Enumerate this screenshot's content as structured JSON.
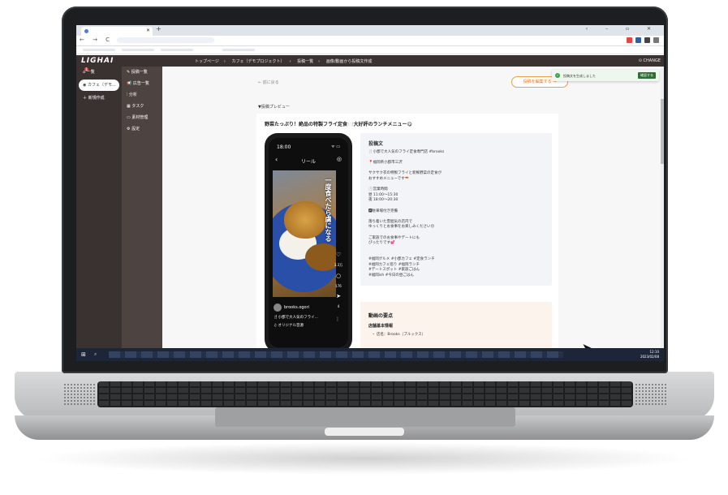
{
  "browser": {
    "tab_title": "",
    "new_tab": "+",
    "window_controls": "‹ – ▫ ✕",
    "nav": "← → C ⌂",
    "url": ""
  },
  "header": {
    "logo": "LIGHAI",
    "breadcrumbs": [
      "トップページ",
      "カフェ（デモプロジェクト）",
      "投稿一覧",
      "画像/動画から投稿文作成"
    ],
    "change": "CHANGE"
  },
  "side1": {
    "items": [
      {
        "label": "一覧",
        "badge": "1"
      },
      {
        "label": "カフェ（デモ..."
      },
      {
        "label": "＋ 新規作成"
      }
    ]
  },
  "side2": {
    "items": [
      "投稿一覧",
      "広告一覧",
      "分析",
      "タスク",
      "素材管理",
      "設定"
    ]
  },
  "main": {
    "back": "← 前に戻る",
    "edit_button": "投稿を編集する →",
    "toast_message": "投稿文を生成しました",
    "toast_button": "確認する",
    "preview_label": "▼投稿プレビュー",
    "post_title": "野菜たっぷり！絶品の特製フライ定食🍽️大好評のランチメニュー😋"
  },
  "phone": {
    "time": "18:00",
    "status": "ᯤ ▭",
    "reel": "リール",
    "overlay": "一度食べたら虜になる",
    "likes": "3.3万",
    "comments": "176",
    "shares": "4",
    "account": "brooks.ogori",
    "caption": "🍴小郡で大人気のフライ...",
    "audio": "♫ オリジナル音源"
  },
  "post_text": {
    "heading": "投稿文",
    "lines": [
      "🍴小郡で大人気のフライ定食専門店 #brooks",
      "",
      "📍福岡県小郡市三沢",
      "",
      "サクサク衣の特製フライと新鮮野菜の定食が",
      "おすすめメニューです🥗",
      "",
      "🕒営業時間",
      "昼 11:00〜15:30",
      "夜 18:00〜20:30",
      "",
      "🅿駐車場付き完備",
      "",
      "落ち着いた雰囲気の店内で",
      "ゆっくりとお食事をお楽しみください😊",
      "",
      "ご家族でのお食事やデートにも",
      "ぴったりです💕",
      "",
      "",
      "#福岡グルメ #小郡カフェ #定食ランチ",
      "#福岡カフェ巡り #福岡ランチ",
      "#デートスポット #家族ごはん",
      "#福岡ish #今日の昼ごはん"
    ]
  },
  "points": {
    "heading": "動画の要点",
    "sub": "店舗基本情報",
    "item": "・ 店名：Brooks（ブルックス）"
  },
  "taskbar": {
    "clock_time": "12:10",
    "clock_date": "2023/02/08"
  }
}
